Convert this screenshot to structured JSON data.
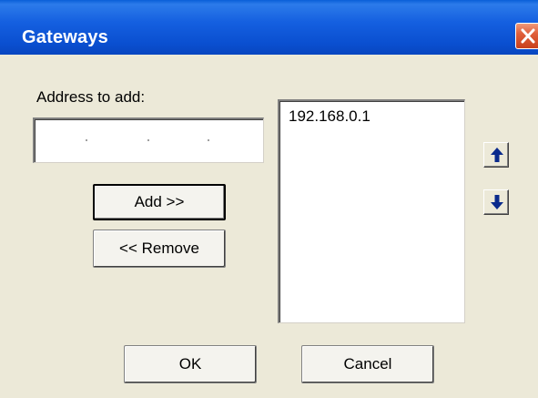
{
  "window": {
    "title": "Gateways"
  },
  "address": {
    "label": "Address to add:",
    "value": ""
  },
  "buttons": {
    "add": "Add >>",
    "remove": "<< Remove",
    "ok": "OK",
    "cancel": "Cancel"
  },
  "gateways": {
    "items": [
      "192.168.0.1"
    ]
  },
  "icons": {
    "close": "close-icon",
    "move_up": "arrow-up-icon",
    "move_down": "arrow-down-icon"
  },
  "colors": {
    "titlebar": "#0A4FD0",
    "close_button": "#E0603C",
    "arrow": "#0A2A8C",
    "dialog_background": "#ECE9D8"
  }
}
